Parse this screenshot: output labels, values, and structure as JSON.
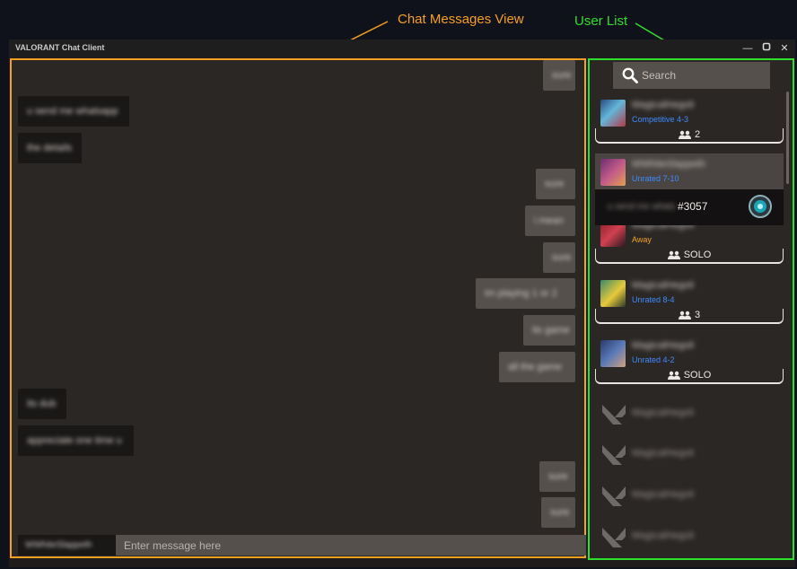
{
  "annotations": {
    "chat_label": "Chat Messages View",
    "users_label": "User List",
    "orange": "#f5a020",
    "green": "#2ee02e"
  },
  "window": {
    "title": "VALORANT Chat Client",
    "controls": [
      "minimize-icon",
      "restore-icon",
      "close-icon"
    ]
  },
  "chat": {
    "messages": [
      {
        "side": "mine",
        "text": "sure"
      },
      {
        "side": "theirs",
        "text": "u send me whatsapp"
      },
      {
        "side": "theirs",
        "text": "the details"
      },
      {
        "side": "mine",
        "text": "sure"
      },
      {
        "side": "mine",
        "text": "i mean"
      },
      {
        "side": "mine",
        "text": "sure"
      },
      {
        "side": "mine",
        "text": "im playing 1 or 2"
      },
      {
        "side": "mine",
        "text": "its game"
      },
      {
        "side": "mine",
        "text": "all the game"
      },
      {
        "side": "theirs",
        "text": "its dub"
      },
      {
        "side": "theirs",
        "text": "appreciate one time u"
      },
      {
        "side": "mine",
        "text": "sure"
      },
      {
        "side": "mine",
        "text": "sure"
      }
    ],
    "input": {
      "sender_name": "WWhiteSlappeth",
      "placeholder": "Enter message here"
    }
  },
  "user_list": {
    "search_placeholder": "Search",
    "users": [
      {
        "name": "MagicalHegoli",
        "status": "Competitive 4-3",
        "status_color": "blue",
        "party": "2"
      },
      {
        "name": "WWhiteSlappeth",
        "status": "Unrated 7-10",
        "status_color": "blue",
        "selected": true
      },
      {
        "name": "MagicalHegoli",
        "status": "Away",
        "status_color": "amber",
        "party": "SOLO"
      },
      {
        "name": "MagicalHegoli",
        "status": "Unrated 8-4",
        "status_color": "blue",
        "party": "3"
      },
      {
        "name": "MagicalHegoli",
        "status": "Unrated 4-2",
        "status_color": "blue",
        "party": "SOLO"
      }
    ],
    "hover_card": {
      "blurred_text": "u send me whats",
      "tag": "#3057"
    },
    "offline": [
      {
        "name": "MagicalHegoli"
      },
      {
        "name": "MagicalHegoli"
      },
      {
        "name": "MagicalHegoli"
      },
      {
        "name": "MagicalHegoli"
      }
    ]
  }
}
